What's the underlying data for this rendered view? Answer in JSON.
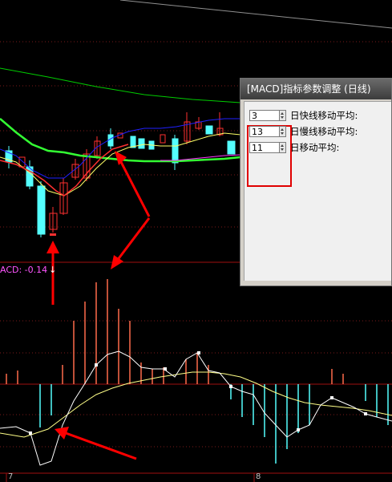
{
  "chart": {
    "macd_label": "ACD: -0.14",
    "macd_arrow": "↓",
    "bottom_ticks": [
      "7",
      "8"
    ]
  },
  "dialog": {
    "title": "[MACD]指标参数调整 (日线)",
    "params": [
      {
        "value": "3",
        "label": "日快线移动平均:"
      },
      {
        "value": "13",
        "label": "日慢线移动平均:"
      },
      {
        "value": "11",
        "label": "日移动平均:"
      }
    ]
  },
  "colors": {
    "up_candle": "#ff3030",
    "down_candle": "#54ffff",
    "macd_up_bar": "#ff6a4a",
    "macd_down_bar": "#54ffff",
    "ma_green": "#00ff00",
    "ma_blue": "#0000ff",
    "ma_yellow": "#ffff66",
    "ma_magenta": "#ff00ff",
    "annotation_red": "#ff0000"
  }
}
